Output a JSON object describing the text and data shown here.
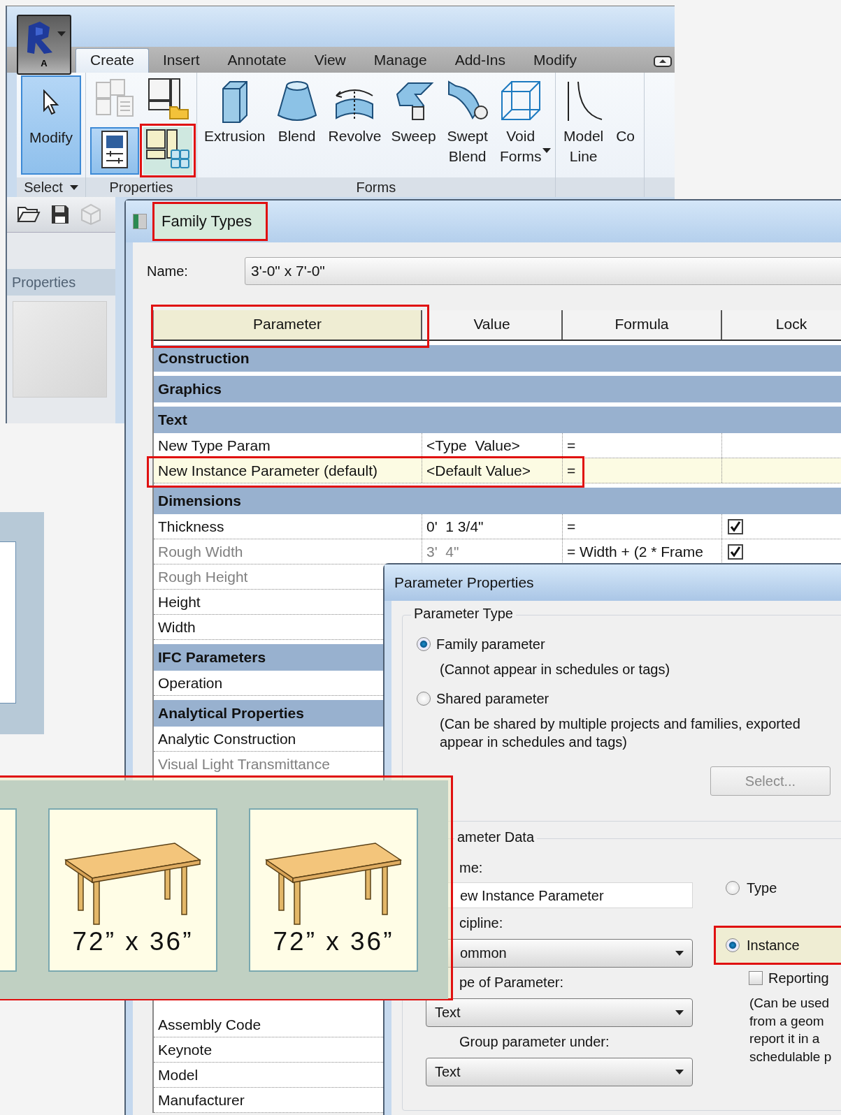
{
  "app": {
    "menu_label": "A",
    "tabs": [
      {
        "label": "Create",
        "selected": true
      },
      {
        "label": "Insert",
        "selected": false
      },
      {
        "label": "Annotate",
        "selected": false
      },
      {
        "label": "View",
        "selected": false
      },
      {
        "label": "Manage",
        "selected": false
      },
      {
        "label": "Add-Ins",
        "selected": false
      },
      {
        "label": "Modify",
        "selected": false
      }
    ],
    "panels": [
      {
        "label": "Select",
        "dropdown": true,
        "tools": [
          {
            "kind": "large",
            "label": "Modify",
            "selected": true
          }
        ]
      },
      {
        "label": "Properties",
        "tools": [
          {
            "kind": "small",
            "selected": false
          },
          {
            "kind": "small",
            "selected": false
          },
          {
            "kind": "small",
            "selected": true
          },
          {
            "kind": "small",
            "selected": false,
            "highlighted": true,
            "hovered": true
          }
        ]
      },
      {
        "label": "Forms",
        "tools": [
          {
            "kind": "large",
            "label": "Extrusion",
            "selected": false
          },
          {
            "kind": "large",
            "label": "Blend",
            "selected": false
          },
          {
            "kind": "large",
            "label": "Revolve",
            "selected": false
          },
          {
            "kind": "large",
            "label": "Sweep",
            "selected": false
          },
          {
            "kind": "large",
            "label": "Swept Blend",
            "selected": false
          },
          {
            "kind": "large",
            "label": "Void Forms",
            "selected": false,
            "dropdown": true
          }
        ]
      },
      {
        "tools": [
          {
            "kind": "large",
            "label": "Model Line",
            "selected": false
          },
          {
            "kind": "large",
            "label": "Co",
            "selected": false
          }
        ]
      }
    ],
    "quick_access": [
      {
        "disabled": false
      },
      {
        "disabled": false
      },
      {
        "disabled": true
      }
    ],
    "sidebar": {
      "title": "Properties"
    }
  },
  "family_types": {
    "title": "Family Types",
    "highlighted": true,
    "name_label": "Name:",
    "name_value": "3'-0\" x 7'-0\"",
    "columns": [
      {
        "label": "Parameter",
        "highlighted": true
      },
      {
        "label": "Value"
      },
      {
        "label": "Formula"
      },
      {
        "label": "Lock"
      }
    ],
    "rows": [
      {
        "kind": "group",
        "label": "Construction"
      },
      {
        "kind": "group",
        "label": "Graphics"
      },
      {
        "kind": "group",
        "label": "Text"
      },
      {
        "kind": "param",
        "label": "New Type Param",
        "value": "<Type  Value>",
        "formula": "=",
        "selected": false,
        "disabled": false
      },
      {
        "kind": "param",
        "label": "New Instance Parameter (default)",
        "value": "<Default Value>",
        "formula": "=",
        "selected": true,
        "disabled": false,
        "highlighted": true
      },
      {
        "kind": "group",
        "label": "Dimensions"
      },
      {
        "kind": "param",
        "label": "Thickness",
        "value": "0'  1 3/4\"",
        "formula": "=",
        "locked": true,
        "selected": false,
        "disabled": false
      },
      {
        "kind": "param",
        "label": "Rough Width",
        "value": "3'  4\"",
        "formula": "= Width + (2 * Frame",
        "locked": true,
        "selected": false,
        "disabled": true
      },
      {
        "kind": "param",
        "label": "Rough Height",
        "selected": false,
        "disabled": true
      },
      {
        "kind": "param",
        "label": "Height",
        "selected": false,
        "disabled": false
      },
      {
        "kind": "param",
        "label": "Width",
        "selected": false,
        "disabled": false
      },
      {
        "kind": "group",
        "label": "IFC Parameters"
      },
      {
        "kind": "param",
        "label": "Operation",
        "selected": false,
        "disabled": false
      },
      {
        "kind": "group",
        "label": "Analytical Properties"
      },
      {
        "kind": "param",
        "label": "Analytic Construction",
        "selected": false,
        "disabled": false
      },
      {
        "kind": "param",
        "label": "Visual Light Transmittance",
        "selected": false,
        "disabled": true
      }
    ],
    "lower_rows": [
      {
        "kind": "param",
        "label": "Assembly Code",
        "selected": false,
        "disabled": false
      },
      {
        "kind": "param",
        "label": "Keynote",
        "selected": false,
        "disabled": false
      },
      {
        "kind": "param",
        "label": "Model",
        "selected": false,
        "disabled": false
      },
      {
        "kind": "param",
        "label": "Manufacturer",
        "selected": false,
        "disabled": false
      }
    ]
  },
  "parameter_properties": {
    "title": "Parameter Properties",
    "type_group": {
      "legend": "Parameter Type",
      "options": [
        {
          "label": "Family parameter",
          "selected": true,
          "note_lines": [
            "(Cannot appear in schedules or tags)"
          ]
        },
        {
          "label": "Shared parameter",
          "selected": false,
          "note_lines": [
            "(Can be shared by multiple projects and families, exported",
            "appear in schedules and tags)"
          ]
        }
      ],
      "select_button": {
        "label": "Select...",
        "disabled": true
      }
    },
    "data_group": {
      "legend": "ameter Data",
      "fields": [
        {
          "kind": "text",
          "label": "me:",
          "value": "ew Instance Parameter"
        },
        {
          "kind": "dropdown",
          "label": "cipline:",
          "value": "ommon"
        },
        {
          "kind": "dropdown",
          "label": "pe of Parameter:",
          "value": "Text"
        },
        {
          "kind": "dropdown",
          "label": "Group parameter under:",
          "value": "Text"
        }
      ],
      "scope": [
        {
          "label": "Type",
          "selected": false
        },
        {
          "label": "Instance",
          "selected": true,
          "highlighted": true
        }
      ],
      "reporting": {
        "label": "Reporting",
        "checked": false
      },
      "reporting_note_lines": [
        "(Can be used",
        "from a geom",
        "report it in a",
        "schedulable p"
      ]
    }
  },
  "gallery": {
    "highlighted": true,
    "cards": [
      {
        "kind": "partial"
      },
      {
        "kind": "table",
        "label": "72” x 36”"
      },
      {
        "kind": "table",
        "label": "72” x 36”"
      }
    ]
  }
}
